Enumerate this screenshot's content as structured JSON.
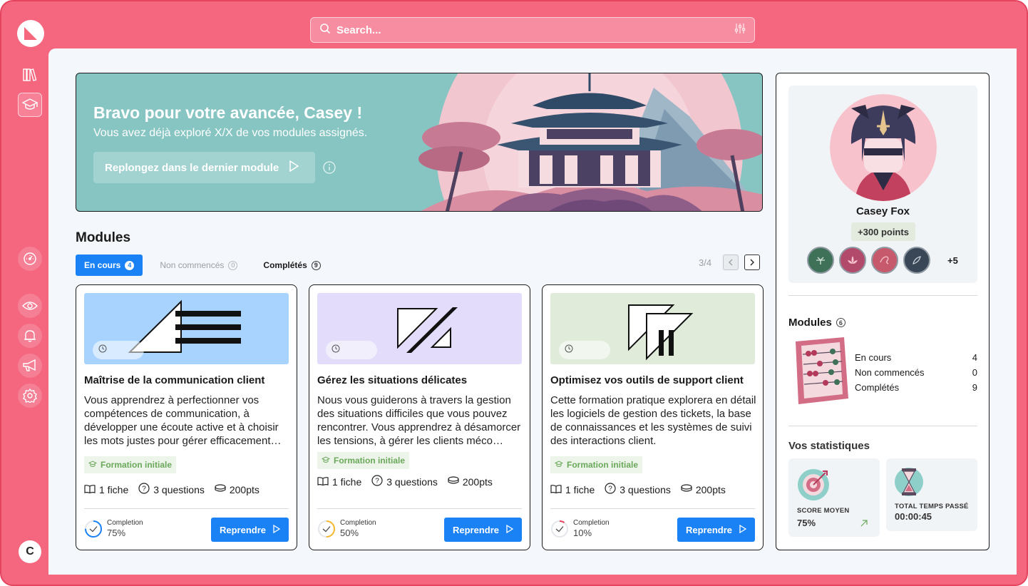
{
  "search": {
    "placeholder": "Search..."
  },
  "user": {
    "initial": "C"
  },
  "hero": {
    "title": "Bravo pour votre avancée, Casey !",
    "subtitle": "Vous avez déjà exploré X/X de vos modules assignés.",
    "cta": "Replongez dans le dernier module"
  },
  "modules": {
    "title": "Modules",
    "tabs": [
      {
        "label": "En cours",
        "count": "4"
      },
      {
        "label": "Non commencés",
        "count": "0"
      },
      {
        "label": "Complétés",
        "count": "9"
      }
    ],
    "pager": "3/4",
    "cards": [
      {
        "title": "Maîtrise de la communication client",
        "description": "Vous apprendrez à perfectionner vos compétences de communication, à développer une écoute active et à choisir les mots justes pour gérer efficacement…",
        "tag": "Formation initiale",
        "fiche": "1 fiche",
        "questions": "3 questions",
        "points": "200pts",
        "completion_label": "Completion",
        "completion": "75%",
        "completion_value": 0.75,
        "button": "Reprendre",
        "thumb_color": "#a9d3ff"
      },
      {
        "title": "Gérez les situations délicates",
        "description": "Nous vous guiderons à travers la gestion des situations difficiles que vous pouvez rencontrer. Vous apprendrez à désamorcer les tensions, à gérer les clients méco…",
        "tag": "Formation initiale",
        "fiche": "1 fiche",
        "questions": "3 questions",
        "points": "200pts",
        "completion_label": "Completion",
        "completion": "50%",
        "completion_value": 0.5,
        "button": "Reprendre",
        "thumb_color": "#e3dcfb"
      },
      {
        "title": "Optimisez vos outils de support client",
        "description": "Cette formation pratique explorera en détail les logiciels de gestion des tickets, la base de connaissances et les systèmes de suivi des interactions client.",
        "tag": "Formation initiale",
        "fiche": "1 fiche",
        "questions": "3 questions",
        "points": "200pts",
        "completion_label": "Completion",
        "completion": "10%",
        "completion_value": 0.1,
        "button": "Reprendre",
        "thumb_color": "#e1ebd9"
      }
    ]
  },
  "profile": {
    "name": "Casey Fox",
    "points": "+300 points",
    "more_badges": "+5",
    "modules_title": "Modules",
    "modules_count": "6",
    "module_stats": [
      {
        "label": "En cours",
        "value": "4"
      },
      {
        "label": "Non commencés",
        "value": "0"
      },
      {
        "label": "Complétés",
        "value": "9"
      }
    ],
    "stats_title": "Vos statistiques",
    "score_label": "SCORE  MOYEN",
    "score_value": "75%",
    "time_label": "TOTAL TEMPS PASSÉ",
    "time_value": "00:00:45"
  },
  "colors": {
    "brand": "#f4677f",
    "primary": "#1a82f5",
    "hero_bg": "#86c5c2"
  }
}
